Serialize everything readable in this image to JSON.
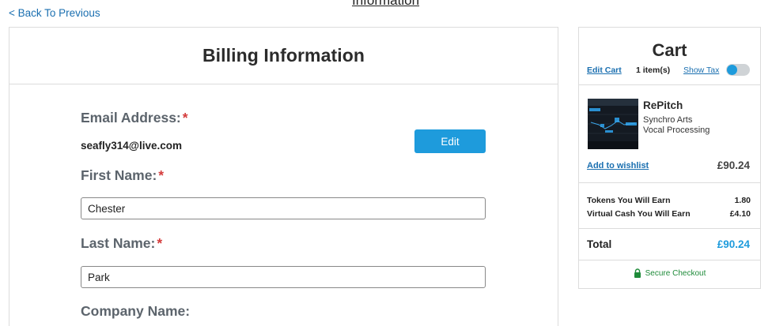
{
  "page": {
    "top_heading": "Information",
    "back_link": "< Back To Previous"
  },
  "billing": {
    "title": "Billing Information",
    "email": {
      "label": "Email Address:",
      "required": "*",
      "value": "seafly314@live.com"
    },
    "edit_button": "Edit",
    "first_name": {
      "label": "First Name:",
      "required": "*",
      "value": "Chester"
    },
    "last_name": {
      "label": "Last Name:",
      "required": "*",
      "value": "Park"
    },
    "company_name": {
      "label": "Company Name:"
    }
  },
  "cart": {
    "title": "Cart",
    "edit_cart": "Edit Cart",
    "item_count": "1 item(s)",
    "show_tax": "Show Tax",
    "show_tax_toggle": false,
    "item": {
      "name": "RePitch",
      "vendor": "Synchro Arts",
      "category": "Vocal Processing",
      "wishlist": "Add to wishlist",
      "price": "£90.24"
    },
    "earnings": [
      {
        "label": "Tokens You Will Earn",
        "value": "1.80"
      },
      {
        "label": "Virtual Cash You Will Earn",
        "value": "£4.10"
      }
    ],
    "total_label": "Total",
    "total_value": "£90.24",
    "secure_checkout": "Secure Checkout"
  },
  "colors": {
    "accent": "#1e9bdc",
    "link": "#1a6fb0",
    "required": "#d43c3c",
    "secure": "#1f8b3a"
  }
}
